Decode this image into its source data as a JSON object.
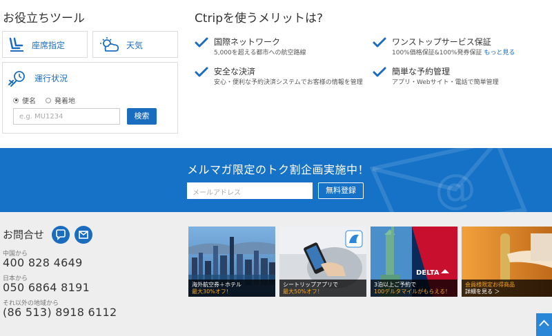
{
  "tools": {
    "title": "お役立ちツール",
    "seat_label": "座席指定",
    "weather_label": "天気",
    "flight_status": {
      "title": "運行状況",
      "radio_flight": "便名",
      "radio_departure": "発着地",
      "input_placeholder": "e.g. MU1234",
      "search_button": "検索"
    }
  },
  "merits": {
    "title": "Ctripを使うメリットは?",
    "items": [
      {
        "title": "国際ネットワーク",
        "desc": "5,000を超える都市への航空路線"
      },
      {
        "title": "ワンストップサービス保証",
        "desc": "100%価格保証&100%発券保証",
        "link": "もっと見る"
      },
      {
        "title": "安全な決済",
        "desc": "安心・便利な予約決済システムでお客様の情報を管理"
      },
      {
        "title": "簡単な予約管理",
        "desc": "アプリ・Webサイト・電話で簡単管理"
      }
    ]
  },
  "newsletter": {
    "title": "メルマガ限定のトク割企画実施中！",
    "email_placeholder": "メールアドレス",
    "register_button": "無料登録"
  },
  "contact": {
    "title": "お問合せ",
    "regions": [
      {
        "label": "中国から",
        "phone": "400 828 4649"
      },
      {
        "label": "日本から",
        "phone": "050 6864 8191"
      },
      {
        "label": "それ以外の地域から",
        "phone": "(86 513) 8918 6112"
      }
    ]
  },
  "banners": [
    {
      "line1": "海外航空券＋ホテル",
      "line2": "最大30%オフ!"
    },
    {
      "line1": "シートリップアプリで",
      "line2": "最大50%オフ！"
    },
    {
      "line1": "3泊以上ご予約で",
      "line2": "100デルタマイルがもらえる！"
    },
    {
      "line1": "会員様限定お得商品",
      "line2": "詳細を見る ＞"
    }
  ],
  "colors": {
    "brand_blue": "#1672c7",
    "accent_orange": "#f7a41d"
  }
}
